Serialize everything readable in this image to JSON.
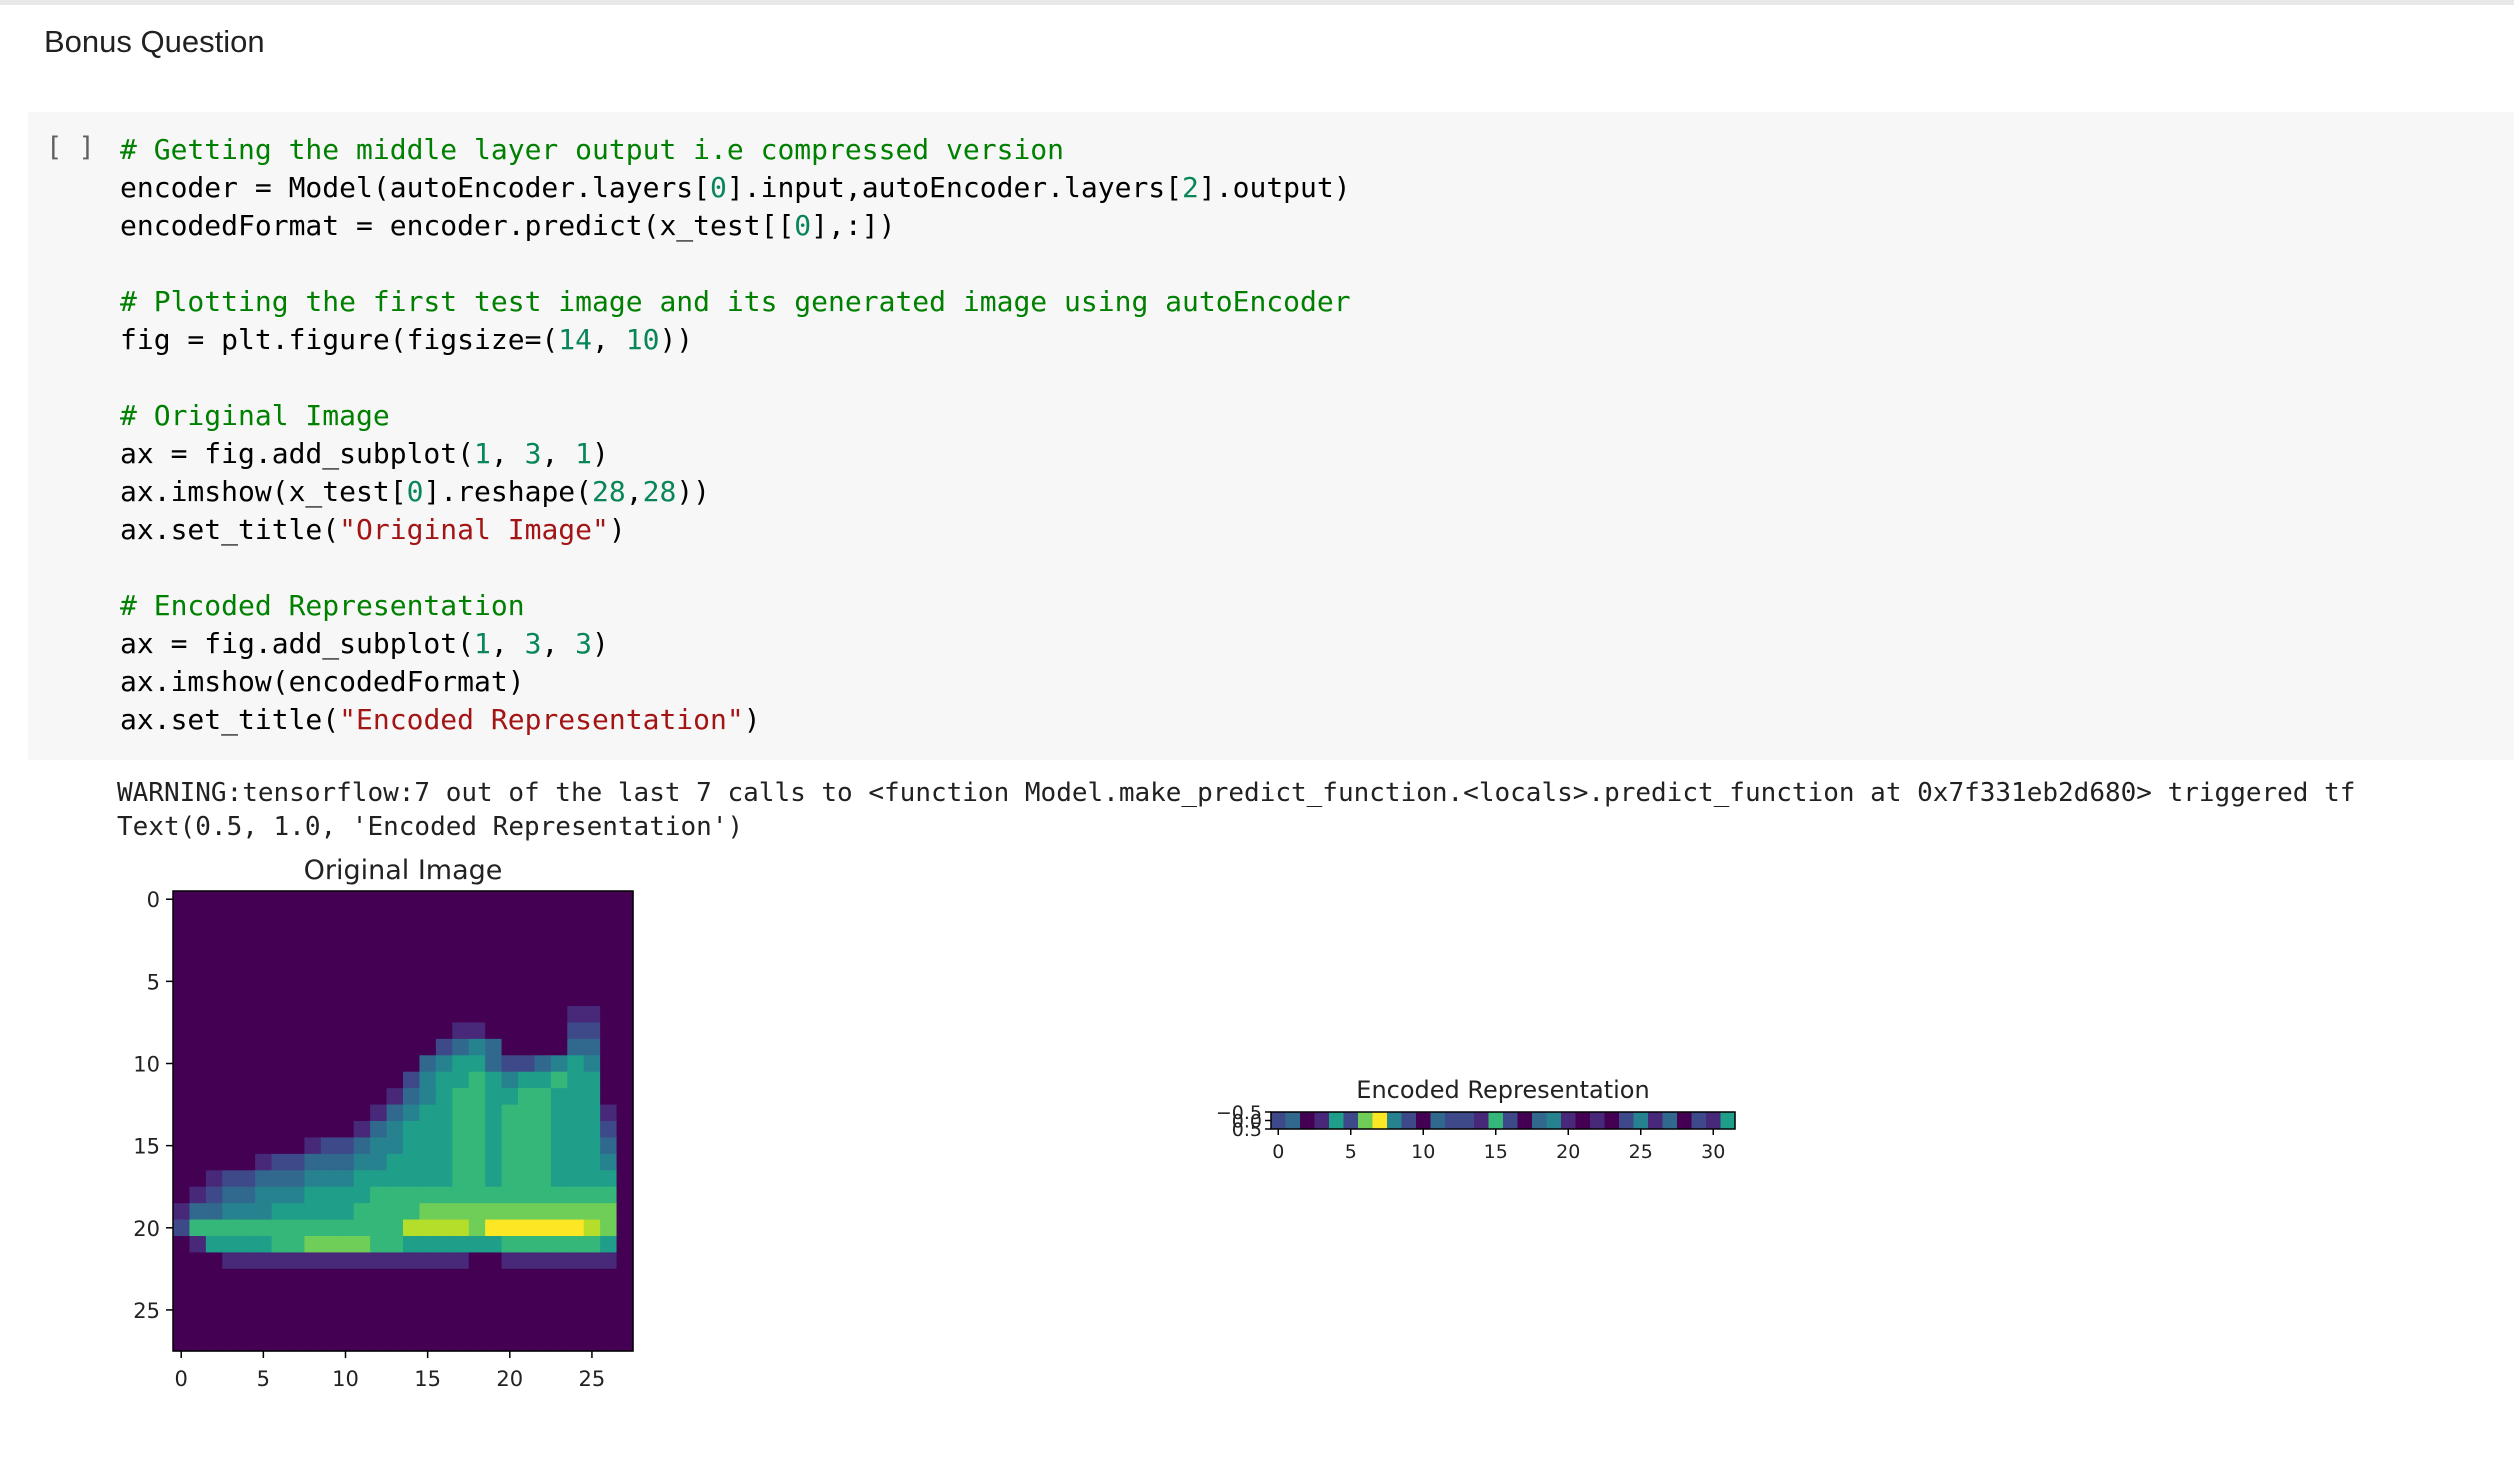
{
  "section": {
    "heading": "Bonus Question"
  },
  "cell": {
    "run_label": "[ ]",
    "code_lines": [
      [
        {
          "t": "# Getting the middle layer output i.e compressed version",
          "k": "c"
        }
      ],
      [
        {
          "t": "encoder = Model(autoEncoder.layers["
        },
        {
          "t": "0",
          "k": "n"
        },
        {
          "t": "].input,autoEncoder.layers["
        },
        {
          "t": "2",
          "k": "n"
        },
        {
          "t": "].output)"
        }
      ],
      [
        {
          "t": "encodedFormat = encoder.predict(x_test[["
        },
        {
          "t": "0",
          "k": "n"
        },
        {
          "t": "],:])"
        }
      ],
      [],
      [
        {
          "t": "# Plotting the first test image and its generated image using autoEncoder",
          "k": "c"
        }
      ],
      [
        {
          "t": "fig = plt.figure(figsize=("
        },
        {
          "t": "14",
          "k": "n"
        },
        {
          "t": ", "
        },
        {
          "t": "10",
          "k": "n"
        },
        {
          "t": "))"
        }
      ],
      [],
      [
        {
          "t": "# Original Image",
          "k": "c"
        }
      ],
      [
        {
          "t": "ax = fig.add_subplot("
        },
        {
          "t": "1",
          "k": "n"
        },
        {
          "t": ", "
        },
        {
          "t": "3",
          "k": "n"
        },
        {
          "t": ", "
        },
        {
          "t": "1",
          "k": "n"
        },
        {
          "t": ")"
        }
      ],
      [
        {
          "t": "ax.imshow(x_test["
        },
        {
          "t": "0",
          "k": "n"
        },
        {
          "t": "].reshape("
        },
        {
          "t": "28",
          "k": "n"
        },
        {
          "t": ","
        },
        {
          "t": "28",
          "k": "n"
        },
        {
          "t": "))"
        }
      ],
      [
        {
          "t": "ax.set_title("
        },
        {
          "t": "\"Original Image\"",
          "k": "s"
        },
        {
          "t": ")"
        }
      ],
      [],
      [
        {
          "t": "# Encoded Representation",
          "k": "c"
        }
      ],
      [
        {
          "t": "ax = fig.add_subplot("
        },
        {
          "t": "1",
          "k": "n"
        },
        {
          "t": ", "
        },
        {
          "t": "3",
          "k": "n"
        },
        {
          "t": ", "
        },
        {
          "t": "3",
          "k": "n"
        },
        {
          "t": ")"
        }
      ],
      [
        {
          "t": "ax.imshow(encodedFormat)"
        }
      ],
      [
        {
          "t": "ax.set_title("
        },
        {
          "t": "\"Encoded Representation\"",
          "k": "s"
        },
        {
          "t": ")"
        }
      ]
    ]
  },
  "output": {
    "warning": "WARNING:tensorflow:7 out of the last 7 calls to <function Model.make_predict_function.<locals>.predict_function at 0x7f331eb2d680> triggered tf",
    "result": "Text(0.5, 1.0, 'Encoded Representation')"
  },
  "colors": {
    "viridis": [
      "#440154",
      "#482878",
      "#3e4989",
      "#31688e",
      "#26828e",
      "#1f9e89",
      "#35b779",
      "#6ece58",
      "#b5de2b",
      "#fde725"
    ]
  },
  "chart_data": [
    {
      "type": "heatmap",
      "title": "Original Image",
      "colormap": "viridis",
      "x_ticks": [
        "0",
        "5",
        "10",
        "15",
        "20",
        "25"
      ],
      "y_ticks": [
        "0",
        "5",
        "10",
        "15",
        "20",
        "25"
      ],
      "xlim": [
        -0.5,
        27.5
      ],
      "ylim": [
        27.5,
        -0.5
      ],
      "grid": false,
      "rows": [
        "0000000000000000000000000000",
        "0000000000000000000000000000",
        "0000000000000000000000000000",
        "0000000000000000000000000000",
        "0000000000000000000000000000",
        "0000000000000000000000000000",
        "0000000000000000000000000000",
        "0000000000000000000000001100",
        "0000000000000000011000002200",
        "0000000000000000234300003300",
        "0000000000000003455322345400",
        "0000000000000024556545565500",
        "0000000000000134566556655500",
        "0000000000001345566566655510",
        "0000000000013455566566655520",
        "0000000012234455566566655530",
        "0000012233344555566566655540",
        "0012233344455555566566655550",
        "0123344455556666666666666660",
        "1334445555566667777777777770",
        "2666666666666688887999999870",
        "0155556677776655555566666650",
        "0001111111111111110011111110",
        "0000000000000000000000000000",
        "0000000000000000000000000000",
        "0000000000000000000000000000",
        "0000000000000000000000000000",
        "0000000000000000000000000000"
      ]
    },
    {
      "type": "heatmap",
      "title": "Encoded Representation",
      "colormap": "viridis",
      "x_ticks": [
        "0",
        "5",
        "10",
        "15",
        "20",
        "25",
        "30"
      ],
      "y_ticks": [
        "−0.5",
        "0.0",
        "0.5"
      ],
      "xlim": [
        -0.5,
        31.5
      ],
      "ylim": [
        0.5,
        -0.5
      ],
      "grid": false,
      "values": [
        2,
        3,
        0,
        1,
        5,
        2,
        7,
        9,
        4,
        2,
        0,
        3,
        2,
        2,
        1,
        6,
        2,
        0,
        3,
        4,
        1,
        0,
        1,
        0,
        2,
        4,
        1,
        3,
        0,
        2,
        1,
        5
      ]
    }
  ]
}
